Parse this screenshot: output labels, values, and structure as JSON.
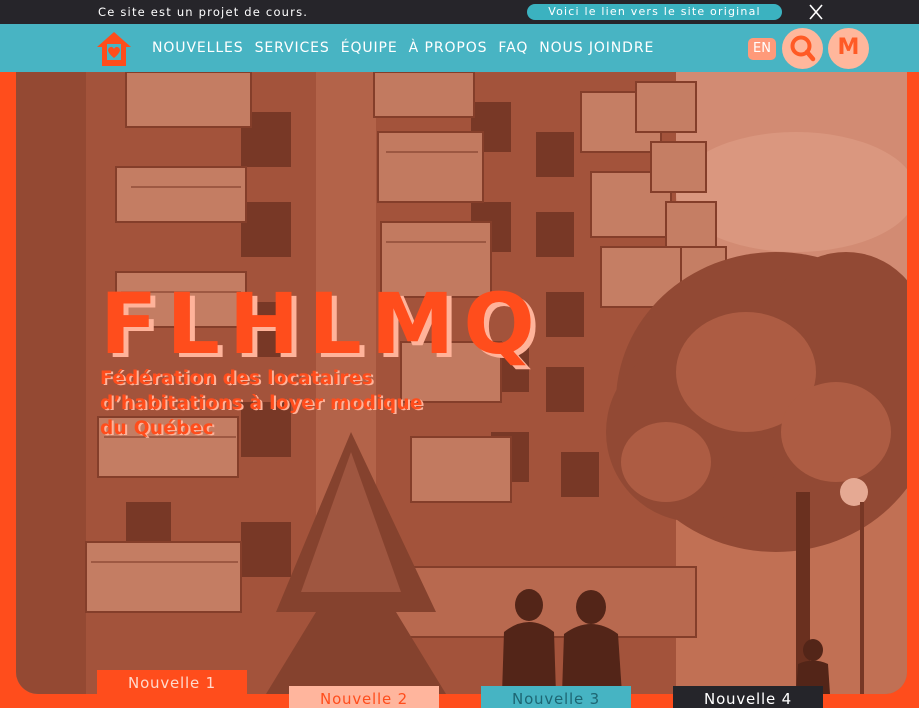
{
  "notice": {
    "message": "Ce site est un projet  de cours.",
    "original_link_label": "Voici le lien vers le site original"
  },
  "nav": {
    "items": [
      {
        "label": "NOUVELLES"
      },
      {
        "label": "SERVICES"
      },
      {
        "label": "ÉQUIPE"
      },
      {
        "label": "À PROPOS"
      },
      {
        "label": "FAQ"
      },
      {
        "label": "NOUS JOINDRE"
      }
    ],
    "lang_label": "EN",
    "member_label": "M"
  },
  "hero": {
    "title": "FLHLMQ",
    "subtitle_lines": [
      "Fédération des locataires",
      "d’habitations à loyer modique",
      "du Québec"
    ]
  },
  "tabs": [
    {
      "label": "Nouvelle 1"
    },
    {
      "label": "Nouvelle 2"
    },
    {
      "label": "Nouvelle 3"
    },
    {
      "label": "Nouvelle 4"
    }
  ],
  "colors": {
    "accent": "#ff4d1c",
    "teal": "#48b4c3",
    "dark": "#26252a",
    "peach": "#ffb59d"
  },
  "icons": {
    "logo": "house-heart-icon",
    "close": "close-icon",
    "search": "search-icon"
  }
}
